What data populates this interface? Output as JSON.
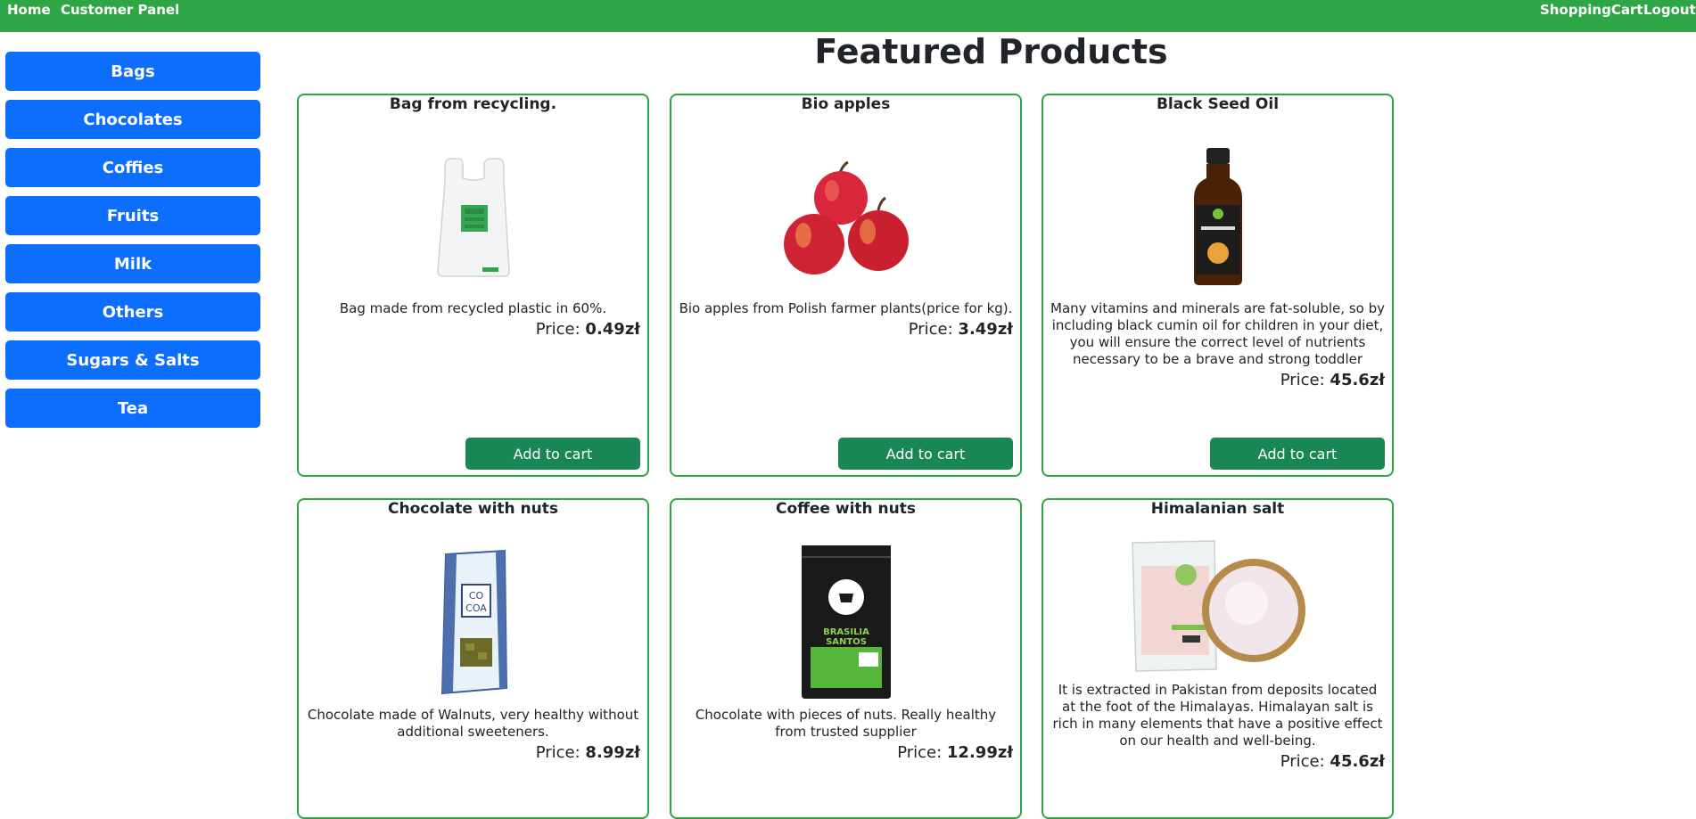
{
  "nav": {
    "home": "Home",
    "customer_panel": "Customer Panel",
    "cart": "ShoppingCart",
    "logout": "Logout"
  },
  "sidebar": {
    "items": [
      "Bags",
      "Chocolates",
      "Coffies",
      "Fruits",
      "Milk",
      "Others",
      "Sugars & Salts",
      "Tea"
    ]
  },
  "main": {
    "title": "Featured Products"
  },
  "products": [
    {
      "name": "Bag from recycling.",
      "description": "Bag made from recycled plastic in 60%.",
      "price_label": "Price:",
      "price": "0.49zł",
      "button": "Add to cart",
      "image_icon": "recycled-bag-icon"
    },
    {
      "name": "Bio apples",
      "description": "Bio apples from Polish farmer plants(price for kg).",
      "price_label": "Price:",
      "price": "3.49zł",
      "button": "Add to cart",
      "image_icon": "apples-icon"
    },
    {
      "name": "Black Seed Oil",
      "description": "Many vitamins and minerals are fat-soluble, so by including black cumin oil for children in your diet, you will ensure the correct level of nutrients necessary to be a brave and strong toddler",
      "price_label": "Price:",
      "price": "45.6zł",
      "button": "Add to cart",
      "image_icon": "oil-bottle-icon"
    },
    {
      "name": "Chocolate with nuts",
      "description": "Chocolate made of Walnuts, very healthy without additional sweeteners.",
      "price_label": "Price:",
      "price": "8.99zł",
      "image_icon": "chocolate-bar-icon",
      "image_text": "CO COA"
    },
    {
      "name": "Coffee with nuts",
      "description": "Chocolate with pieces of nuts. Really healthy from trusted supplier",
      "price_label": "Price:",
      "price": "12.99zł",
      "image_icon": "coffee-bag-icon",
      "image_text": "BRASILIA SANTOS"
    },
    {
      "name": "Himalanian salt",
      "description": "It is extracted in Pakistan from deposits located at the foot of the Himalayas. Himalayan salt is rich in many elements that have a positive effect on our health and well-being.",
      "price_label": "Price:",
      "price": "45.6zł",
      "image_icon": "salt-bowl-icon"
    }
  ],
  "colors": {
    "topbar": "#2ea646",
    "category_button": "#0d6efd",
    "add_button": "#198754",
    "card_border": "#2ea646"
  }
}
